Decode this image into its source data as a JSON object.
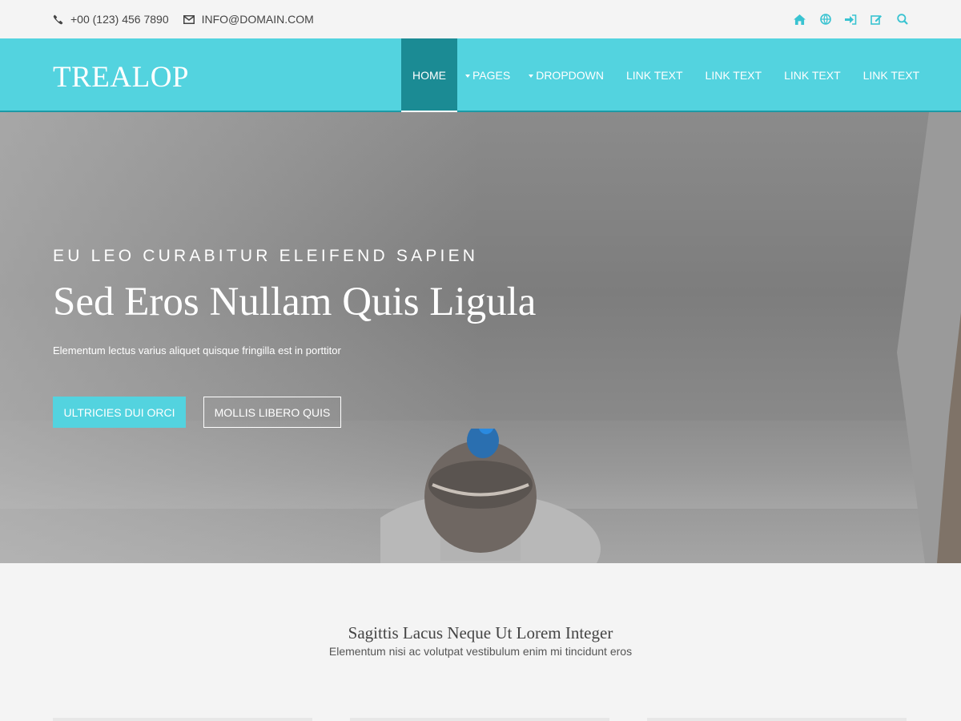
{
  "topbar": {
    "phone": "+00 (123) 456 7890",
    "email": "INFO@DOMAIN.COM",
    "icons": [
      "home-icon",
      "globe-icon",
      "sign-in-icon",
      "edit-icon",
      "search-icon"
    ]
  },
  "navbar": {
    "brand": "TREALOP",
    "items": [
      {
        "label": "HOME",
        "active": true
      },
      {
        "label": "PAGES",
        "dropdown": true
      },
      {
        "label": "DROPDOWN",
        "dropdown": true
      },
      {
        "label": "LINK TEXT"
      },
      {
        "label": "LINK TEXT"
      },
      {
        "label": "LINK TEXT"
      },
      {
        "label": "LINK TEXT"
      }
    ]
  },
  "hero": {
    "subtitle": "EU LEO CURABITUR ELEIFEND SAPIEN",
    "title": "Sed Eros Nullam Quis Ligula",
    "description": "Elementum lectus varius aliquet quisque fringilla est in porttitor",
    "primary_button": "ULTRICIES DUI ORCI",
    "secondary_button": "MOLLIS LIBERO QUIS"
  },
  "section": {
    "title": "Sagittis Lacus Neque Ut Lorem Integer",
    "subtitle": "Elementum nisi ac volutpat vestibulum enim mi tincidunt eros"
  },
  "colors": {
    "accent": "#53d3df",
    "active_nav": "#1b8b94",
    "icon": "#39c3d1"
  }
}
